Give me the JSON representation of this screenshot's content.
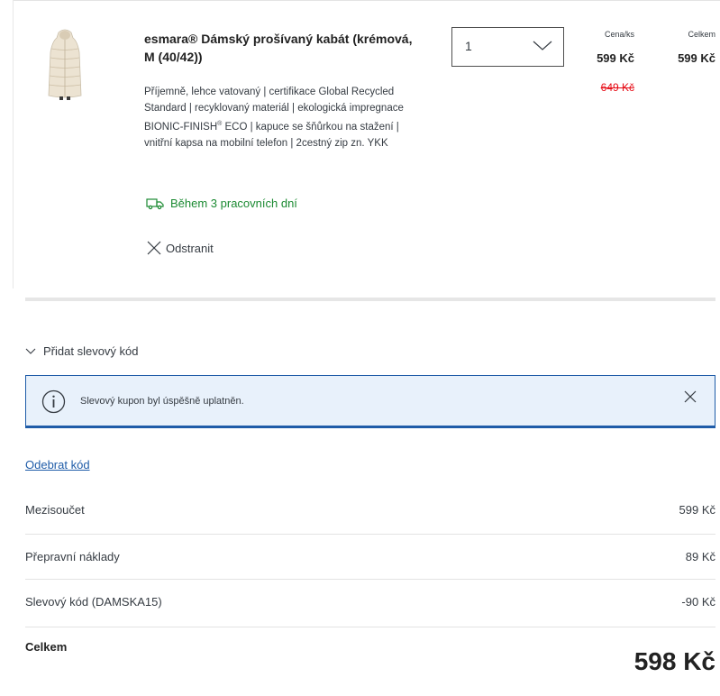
{
  "product": {
    "title": "esmara® Dámský prošívaný kabát (krémová, M (40/42))",
    "desc_lines": [
      "Příjemně, lehce vatovaný | certifikace Global Recycled",
      "Standard | recyklovaný materiál | ekologická impregnace",
      "BIONIC-FINISH",
      " ECO | kapuce se šňůrkou na stažení |",
      "vnitřní kapsa na mobilní telefon | 2cestný zip zn. YKK"
    ],
    "desc_sup": "®",
    "image_icon": "coat-image",
    "quantity": "1",
    "delivery": "Během 3 pracovních dní",
    "remove_label": "Odstranit"
  },
  "price": {
    "unit_header": "Cena/ks",
    "total_header": "Celkem",
    "unit_price": "599 Kč",
    "total_price": "599 Kč",
    "old_price": "649 Kč"
  },
  "coupon": {
    "toggle_label": "Přidat slevový kód",
    "info_message": "Slevový kupon byl úspěšně uplatněn.",
    "remove_code": "Odebrat kód"
  },
  "summary": {
    "rows": [
      {
        "label": "Mezisoučet",
        "value": "599 Kč"
      },
      {
        "label": "Přepravní náklady",
        "value": "89 Kč"
      },
      {
        "label": "Slevový kód (DAMSKA15)",
        "value": "-90 Kč"
      }
    ],
    "total_label": "Celkem",
    "total_value": "598 Kč"
  },
  "colors": {
    "delivery_green": "#1b8a32",
    "old_price_red": "#e60a14",
    "info_blue": "#1f5ca8",
    "info_bg": "#e8f1fb"
  }
}
